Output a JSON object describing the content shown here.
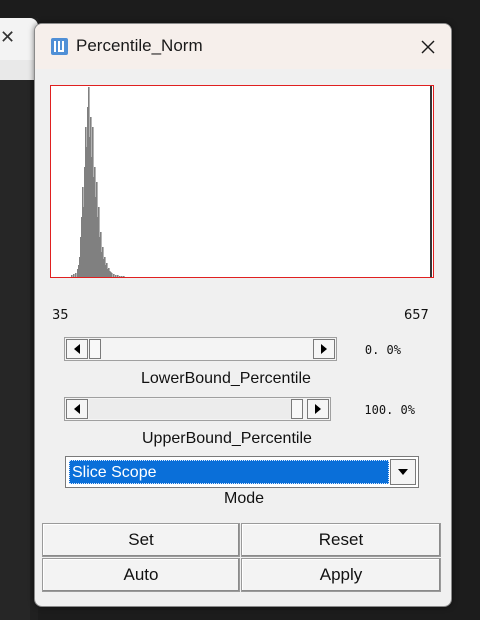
{
  "window": {
    "title": "Percentile_Norm",
    "close_symbol": "✕"
  },
  "histogram": {
    "min_label": "35",
    "max_label": "657",
    "bar_color": "#808080",
    "border_color": "#e02020"
  },
  "lower_bound": {
    "value_text": "0. 0%",
    "label": "LowerBound_Percentile",
    "percent": 0.0
  },
  "upper_bound": {
    "value_text": "100. 0%",
    "label": "UpperBound_Percentile",
    "percent": 100.0
  },
  "mode": {
    "selected": "Slice Scope",
    "label": "Mode"
  },
  "buttons": {
    "set": "Set",
    "reset": "Reset",
    "auto": "Auto",
    "apply": "Apply"
  },
  "colors": {
    "selection": "#0a6fd9",
    "dialog_bg": "#f0f0f0",
    "titlebar_bg": "#f6efeb"
  }
}
